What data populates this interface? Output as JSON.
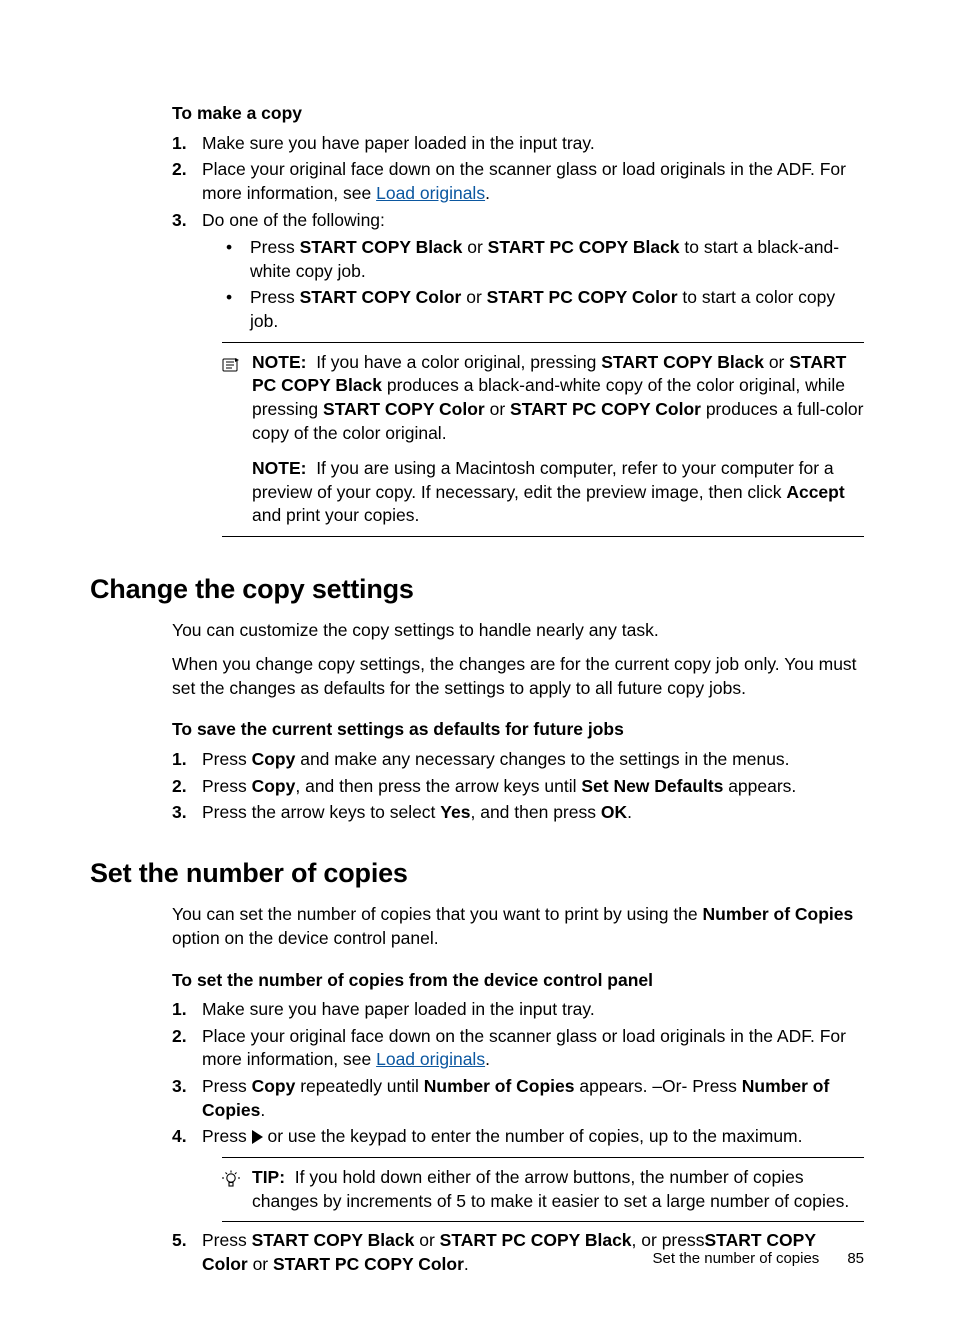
{
  "section1": {
    "subtitle": "To make a copy",
    "steps": {
      "s1": "Make sure you have paper loaded in the input tray.",
      "s2a": "Place your original face down on the scanner glass or load originals in the ADF. For more information, see ",
      "s2link": "Load originals",
      "s2b": ".",
      "s3": "Do one of the following:",
      "b1a": "Press ",
      "b1b": "START COPY Black",
      "b1c": " or ",
      "b1d": "START PC COPY Black",
      "b1e": " to start a black-and-white copy job.",
      "b2a": "Press ",
      "b2b": "START COPY Color",
      "b2c": " or ",
      "b2d": "START PC COPY Color",
      "b2e": " to start a color copy job."
    },
    "note1": {
      "l": "NOTE:",
      "t1": "If you have a color original, pressing ",
      "b1": "START COPY Black",
      "t2": " or ",
      "b2": "START PC COPY Black",
      "t3": " produces a black-and-white copy of the color original, while pressing ",
      "b3": "START COPY Color",
      "t4": " or ",
      "b4": "START PC COPY Color",
      "t5": " produces a full-color copy of the color original."
    },
    "note2": {
      "l": "NOTE:",
      "t1": "If you are using a Macintosh computer, refer to your computer for a preview of your copy. If necessary, edit the preview image, then click ",
      "b1": "Accept",
      "t2": " and print your copies."
    }
  },
  "section2": {
    "heading": "Change the copy settings",
    "p1": "You can customize the copy settings to handle nearly any task.",
    "p2": "When you change copy settings, the changes are for the current copy job only. You must set the changes as defaults for the settings to apply to all future copy jobs.",
    "subtitle": "To save the current settings as defaults for future jobs",
    "steps": {
      "s1a": "Press ",
      "s1b": "Copy",
      "s1c": " and make any necessary changes to the settings in the menus.",
      "s2a": "Press ",
      "s2b": "Copy",
      "s2c": ", and then press the arrow keys until ",
      "s2d": "Set New Defaults",
      "s2e": " appears.",
      "s3a": "Press the arrow keys to select ",
      "s3b": "Yes",
      "s3c": ", and then press ",
      "s3d": "OK",
      "s3e": "."
    }
  },
  "section3": {
    "heading": "Set the number of copies",
    "p1a": "You can set the number of copies that you want to print by using the ",
    "p1b": "Number of Copies",
    "p1c": " option on the device control panel.",
    "subtitle": "To set the number of copies from the device control panel",
    "steps": {
      "s1": "Make sure you have paper loaded in the input tray.",
      "s2a": "Place your original face down on the scanner glass or load originals in the ADF. For more information, see ",
      "s2link": "Load originals",
      "s2b": ".",
      "s3a": "Press ",
      "s3b": "Copy",
      "s3c": " repeatedly until ",
      "s3d": "Number of Copies",
      "s3e": " appears. –Or- Press ",
      "s3f": "Number of Copies",
      "s3g": ".",
      "s4a": "Press ",
      "s4b": " or use the keypad to enter the number of copies, up to the maximum.",
      "s5a": "Press ",
      "s5b": "START COPY Black",
      "s5c": " or ",
      "s5d": "START PC COPY Black",
      "s5e": ", or press",
      "s5f": "START COPY Color",
      "s5g": " or ",
      "s5h": "START PC COPY Color",
      "s5i": "."
    },
    "tip": {
      "l": "TIP:",
      "t": "If you hold down either of the arrow buttons, the number of copies changes by increments of 5 to make it easier to set a large number of copies."
    }
  },
  "footer": {
    "section": "Set the number of copies",
    "page": "85"
  }
}
